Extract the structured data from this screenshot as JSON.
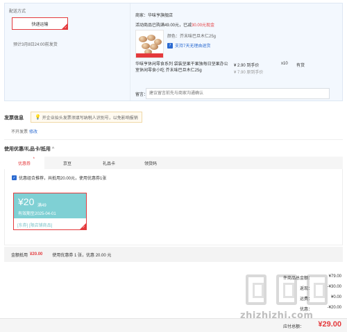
{
  "shipping": {
    "title": "配送方式",
    "method_button": "快递运输",
    "estimate": "预计3月8日24:00前发货"
  },
  "store": {
    "name": "商家：华味亨旗舰店",
    "promo_prefix": "活动商品已购满49.00元，已减",
    "promo_highlight": "30.00元现金"
  },
  "product": {
    "spec": "颜色：芥末味巴旦木仁25g",
    "return_badge": "7",
    "return_label": "支持7天无理由退货",
    "name": "华味亨休闲零食系列 袋装坚果干果独每日坚果办公室休闲零食小吃 芥末味巴旦木仁25g",
    "price": "¥ 2.90 到手价",
    "price_old": "¥ 7.90 原到手价",
    "quantity": "x10",
    "stock": "有货"
  },
  "note": {
    "label": "留言：",
    "placeholder": "建议留言前先与商家沟通确认"
  },
  "invoice": {
    "title": "发票信息",
    "tip": "开企业抬头发票须填写纳税人识别号，以免影响报销",
    "status": "不开发票",
    "edit": "修改"
  },
  "coupons": {
    "title": "使用优惠/礼品卡/抵用",
    "chevron": "^",
    "tabs": [
      {
        "label": "优惠券",
        "star": "*"
      },
      {
        "label": "京豆"
      },
      {
        "label": "礼品卡"
      },
      {
        "label": "领货码"
      }
    ],
    "combo_text": "优惠组合推荐，共抵用20.00元，使用优惠券1张",
    "card": {
      "amount": "¥20",
      "condition": "满49",
      "valid": "有效期至2025-04-01",
      "scope": "[东券] [限店铺商品]"
    },
    "summary_label": "金额抵用",
    "summary_amount": "¥20.00",
    "summary_detail": "使用优惠券 1 张，优惠 20.00 元"
  },
  "summary": {
    "goods_label": "件商品总金额：",
    "goods_value": "¥79.00",
    "row2_label": "返现：",
    "row2_value": "-¥30.00",
    "row3_label": "运费：",
    "row3_value": "¥0.00",
    "row4_label": "优惠：",
    "row4_value": "-¥20.00"
  },
  "payment": {
    "label": "应付总额：",
    "amount": "¥29.00"
  },
  "watermark": {
    "text": "zhizhizhi.com"
  }
}
